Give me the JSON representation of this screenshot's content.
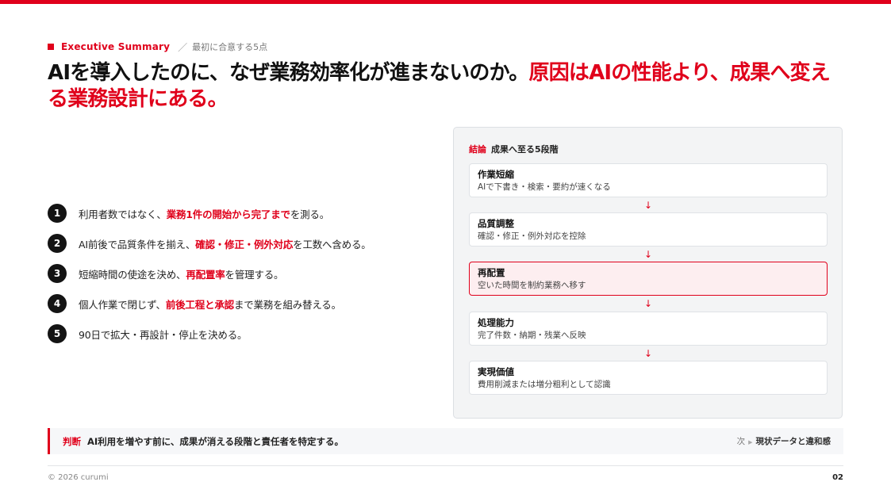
{
  "header": {
    "label_en": "Executive Summary",
    "label_sub": "最初に合意する5点",
    "headline_black": "AIを導入したのに、なぜ業務効率化が進まないのか。",
    "headline_red": "原因はAIの性能より、成果へ変える業務設計にある。"
  },
  "points": [
    {
      "num": "1",
      "pre": "利用者数ではなく、",
      "hl": "業務1件の開始から完了まで",
      "post": "を測る。"
    },
    {
      "num": "2",
      "pre": "AI前後で品質条件を揃え、",
      "hl": "確認・修正・例外対応",
      "post": "を工数へ含める。"
    },
    {
      "num": "3",
      "pre": "短縮時間の使途を決め、",
      "hl": "再配置率",
      "post": "を管理する。"
    },
    {
      "num": "4",
      "pre": "個人作業で閉じず、",
      "hl": "前後工程と承認",
      "post": "まで業務を組み替える。"
    },
    {
      "num": "5",
      "pre": "90日で拡大・再設計・停止を決める。",
      "hl": "",
      "post": ""
    }
  ],
  "panel": {
    "tag": "結論",
    "title": "成果へ至る5段階",
    "arrow": "↓",
    "steps": [
      {
        "title": "作業短縮",
        "desc": "AIで下書き・検索・要約が速くなる"
      },
      {
        "title": "品質調整",
        "desc": "確認・修正・例外対応を控除"
      },
      {
        "title": "再配置",
        "desc": "空いた時間を制約業務へ移す"
      },
      {
        "title": "処理能力",
        "desc": "完了件数・納期・残業へ反映"
      },
      {
        "title": "実現価値",
        "desc": "費用削減または増分粗利として認識"
      }
    ]
  },
  "judgement": {
    "tag": "判断",
    "text": "AI利用を増やす前に、成果が消える段階と責任者を特定する。",
    "next_label": "次",
    "next_marker": "▶",
    "next_text": "現状データと違和感"
  },
  "footer": {
    "copyright": "© 2026 curumi",
    "page": "02"
  },
  "colors": {
    "accent": "#e0001b",
    "text": "#111111",
    "panel_bg": "#f3f4f5",
    "active_bg": "#fdeef0"
  }
}
